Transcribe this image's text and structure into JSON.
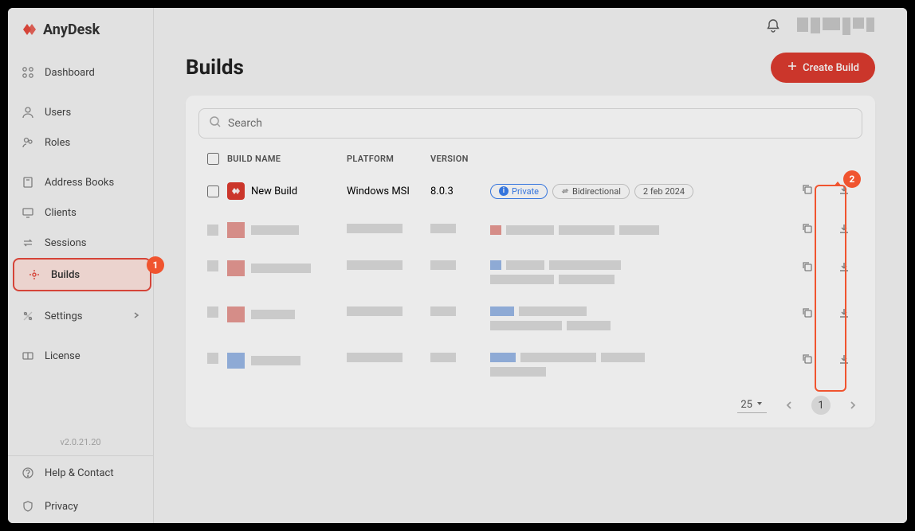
{
  "brand": {
    "name": "AnyDesk"
  },
  "sidebar": {
    "items": [
      {
        "label": "Dashboard"
      },
      {
        "label": "Users"
      },
      {
        "label": "Roles"
      },
      {
        "label": "Address Books"
      },
      {
        "label": "Clients"
      },
      {
        "label": "Sessions"
      },
      {
        "label": "Builds"
      },
      {
        "label": "Settings"
      },
      {
        "label": "License"
      }
    ],
    "bottom": [
      {
        "label": "Help & Contact"
      },
      {
        "label": "Privacy"
      }
    ],
    "version": "v2.0.21.20"
  },
  "page": {
    "title": "Builds",
    "create_btn": "Create Build",
    "search_placeholder": "Search"
  },
  "table": {
    "headers": {
      "name": "BUILD NAME",
      "platform": "PLATFORM",
      "version": "VERSION"
    },
    "rows": [
      {
        "name": "New Build",
        "platform": "Windows MSI",
        "version": "8.0.3",
        "tags": {
          "private": "Private",
          "direction": "Bidirectional",
          "date": "2 feb 2024"
        }
      }
    ]
  },
  "pagination": {
    "page_size": "25",
    "current_page": "1"
  },
  "callouts": {
    "one": "1",
    "two": "2"
  }
}
